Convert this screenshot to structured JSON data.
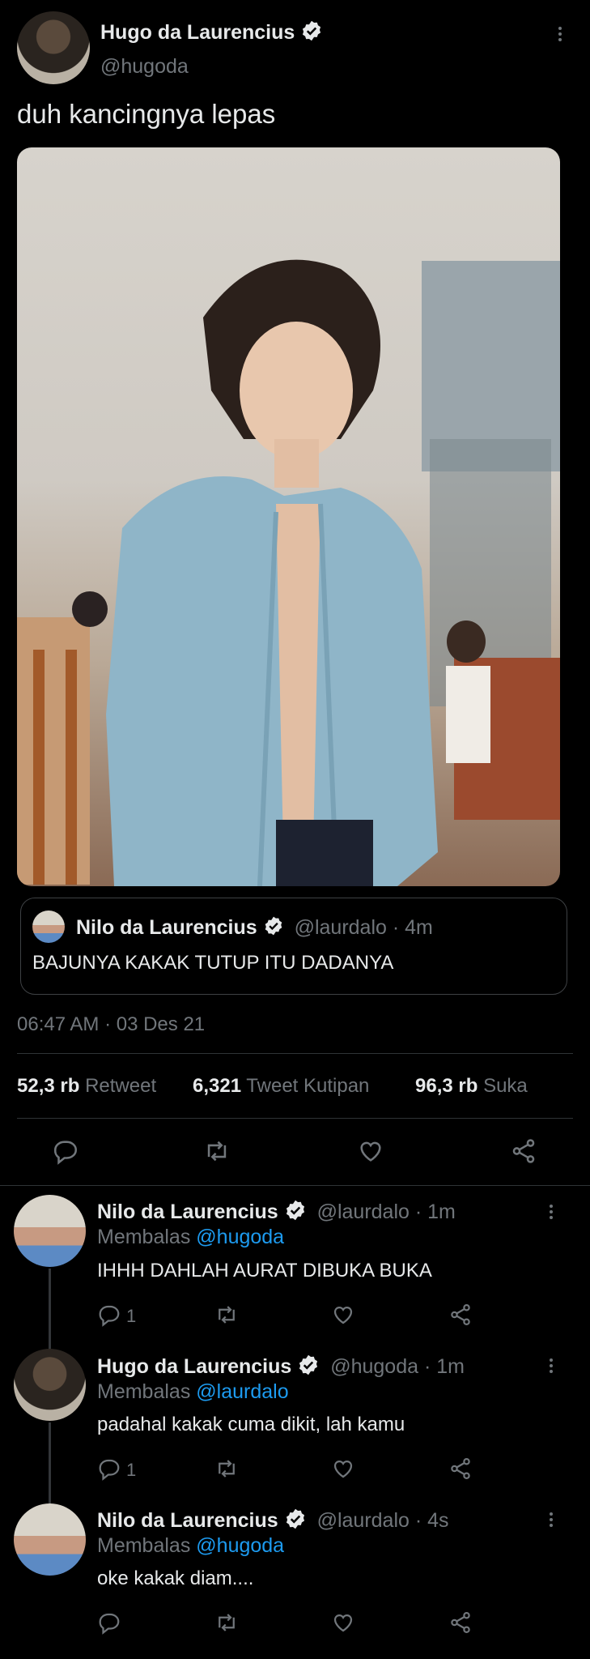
{
  "tweet": {
    "author_name": "Hugo da Laurencius",
    "author_handle": "@hugoda",
    "text": "duh kancingnya lepas",
    "timestamp": "06:47 AM · 03 Des 21",
    "quote": {
      "author_name": "Nilo da Laurencius",
      "meta": "@laurdalo · 4m",
      "text": "BAJUNYA KAKAK TUTUP ITU DADANYA"
    },
    "stats": [
      {
        "value": "52,3 rb",
        "label": "Retweet"
      },
      {
        "value": "6,321",
        "label": "Tweet Kutipan"
      },
      {
        "value": "96,3 rb",
        "label": "Suka"
      }
    ],
    "actions": [
      "reply-icon",
      "retweet-icon",
      "like-icon",
      "share-icon"
    ]
  },
  "replies": [
    {
      "author_name": "Nilo da Laurencius",
      "meta": "@laurdalo · 1m",
      "replying_prefix": "Membalas",
      "replying_to": "@hugoda",
      "text": "IHHH DAHLAH AURAT DIBUKA BUKA",
      "reply_count": "1"
    },
    {
      "author_name": "Hugo da Laurencius",
      "meta": "@hugoda · 1m",
      "replying_prefix": "Membalas",
      "replying_to": "@laurdalo",
      "text": "padahal kakak cuma dikit, lah kamu",
      "reply_count": "1"
    },
    {
      "author_name": "Nilo da Laurencius",
      "meta": "@laurdalo · 4s",
      "replying_prefix": "Membalas",
      "replying_to": "@hugoda",
      "text": "oke kakak diam....",
      "reply_count": ""
    }
  ],
  "colors": {
    "background": "#000000",
    "text": "#e7e9ea",
    "muted": "#71767b",
    "accent": "#1d9bf0",
    "divider": "#2f3336"
  }
}
